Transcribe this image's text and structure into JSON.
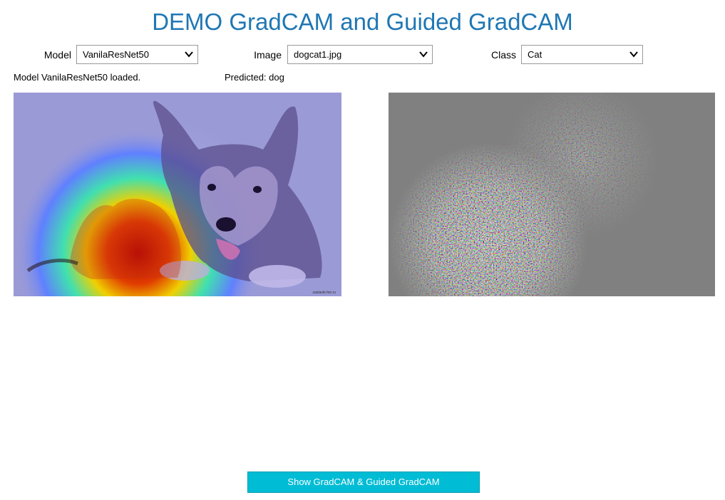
{
  "title": "DEMO GradCAM and Guided GradCAM",
  "controls": {
    "model": {
      "label": "Model",
      "value": "VanilaResNet50"
    },
    "image": {
      "label": "Image",
      "value": "dogcat1.jpg"
    },
    "class": {
      "label": "Class",
      "value": "Cat"
    }
  },
  "status": {
    "loaded": "Model VanilaResNet50 loaded.",
    "predicted": "Predicted: dog"
  },
  "panels": {
    "gradcam": {
      "watermark": "zastavki-fon.ru"
    }
  },
  "button": {
    "label": "Show GradCAM & Guided GradCAM"
  },
  "colors": {
    "title": "#1f77b4",
    "button_bg": "#00bcd4",
    "guided_bg": "#808080",
    "overlay_tint": "#9a9ad6"
  },
  "icons": {
    "dropdown": "chevron-down-icon"
  }
}
